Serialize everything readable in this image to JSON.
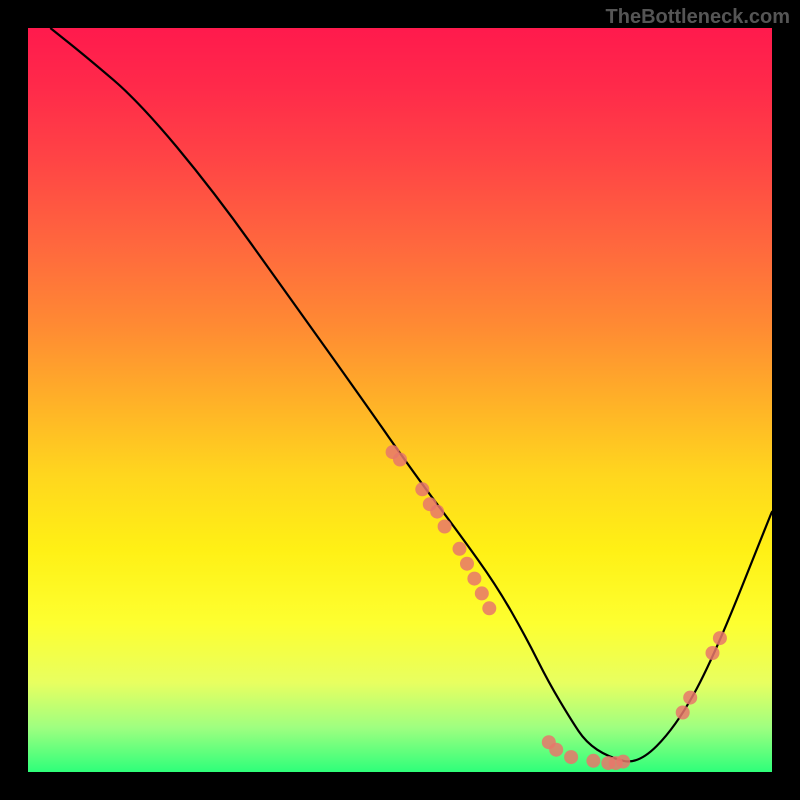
{
  "watermark": "TheBottleneck.com",
  "chart_data": {
    "type": "line",
    "title": "",
    "xlabel": "",
    "ylabel": "",
    "xlim": [
      0,
      100
    ],
    "ylim": [
      0,
      100
    ],
    "series": [
      {
        "name": "curve",
        "x": [
          3,
          8,
          15,
          25,
          35,
          45,
          52,
          58,
          63,
          67,
          70,
          73,
          75,
          78,
          82,
          87,
          92,
          100
        ],
        "values": [
          100,
          96,
          90,
          78,
          64,
          50,
          40,
          32,
          25,
          18,
          12,
          7,
          4,
          2,
          1,
          6,
          15,
          35
        ]
      }
    ],
    "scatter_points": {
      "name": "highlighted-points",
      "color": "#e8776b",
      "points": [
        {
          "x": 49,
          "y": 43
        },
        {
          "x": 50,
          "y": 42
        },
        {
          "x": 53,
          "y": 38
        },
        {
          "x": 54,
          "y": 36
        },
        {
          "x": 55,
          "y": 35
        },
        {
          "x": 56,
          "y": 33
        },
        {
          "x": 58,
          "y": 30
        },
        {
          "x": 59,
          "y": 28
        },
        {
          "x": 60,
          "y": 26
        },
        {
          "x": 61,
          "y": 24
        },
        {
          "x": 62,
          "y": 22
        },
        {
          "x": 70,
          "y": 4
        },
        {
          "x": 71,
          "y": 3
        },
        {
          "x": 73,
          "y": 2
        },
        {
          "x": 76,
          "y": 1.5
        },
        {
          "x": 78,
          "y": 1.2
        },
        {
          "x": 79,
          "y": 1.2
        },
        {
          "x": 80,
          "y": 1.4
        },
        {
          "x": 88,
          "y": 8
        },
        {
          "x": 89,
          "y": 10
        },
        {
          "x": 92,
          "y": 16
        },
        {
          "x": 93,
          "y": 18
        }
      ]
    },
    "gradient_stops": [
      {
        "pos": 0,
        "color": "#ff1a4d"
      },
      {
        "pos": 50,
        "color": "#ffb028"
      },
      {
        "pos": 80,
        "color": "#fdff30"
      },
      {
        "pos": 100,
        "color": "#2eff7a"
      }
    ]
  }
}
